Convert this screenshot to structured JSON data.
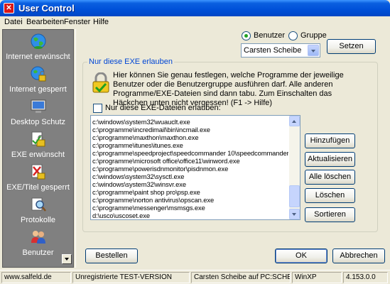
{
  "window": {
    "title": "User Control"
  },
  "menu": [
    "Datei",
    "Bearbeiten",
    "Fenster",
    "Hilfe"
  ],
  "sidebar": {
    "items": [
      {
        "label": "Internet erwünscht",
        "icon": "globe-icon"
      },
      {
        "label": "Internet gesperrt",
        "icon": "globe-lock-icon"
      },
      {
        "label": "Desktop Schutz",
        "icon": "monitor-icon"
      },
      {
        "label": "EXE erwünscht",
        "icon": "exe-lock-icon"
      },
      {
        "label": "EXE/Titel gesperrt",
        "icon": "exe-blocked-icon"
      },
      {
        "label": "Protokolle",
        "icon": "magnifier-icon"
      },
      {
        "label": "Benutzer",
        "icon": "users-icon"
      }
    ]
  },
  "selector": {
    "radio_user": "Benutzer",
    "radio_group": "Gruppe",
    "selected_user": "Carsten Scheibe",
    "set_button": "Setzen"
  },
  "group": {
    "legend": "Nur diese EXE erlauben",
    "info": "Hier können Sie genau festlegen, welche Programme der jeweilige Benutzer oder die Benutzergruppe ausführen darf. Alle anderen Programme/EXE-Dateien sind dann tabu. Zum Einschalten das Häckchen unten nicht vergessen! (F1 -> Hilfe)",
    "checkbox_label": "Nur diese EXE-Dateien erlauben:",
    "files": [
      "c:\\windows\\system32\\wuauclt.exe",
      "c:\\programme\\incredimail\\bin\\incmail.exe",
      "c:\\programme\\maxthon\\maxthon.exe",
      "c:\\programme\\itunes\\itunes.exe",
      "c:\\programme\\speedproject\\speedcommander 10\\speedcommander.exe",
      "c:\\programme\\microsoft office\\office11\\winword.exe",
      "c:\\programme\\powerisdnmonitor\\pisdnmon.exe",
      "c:\\windows\\system32\\sysctl.exe",
      "c:\\windows\\system32\\winsvr.exe",
      "c:\\programme\\paint shop pro\\psp.exe",
      "c:\\programme\\norton antivirus\\opscan.exe",
      "c:\\programme\\messenger\\msmsgs.exe",
      "d:\\usco\\uscoset.exe"
    ],
    "buttons": {
      "add": "Hinzufügen",
      "refresh": "Aktualisieren",
      "delete_all": "Alle löschen",
      "delete": "Löschen",
      "sort": "Sortieren"
    }
  },
  "footer_buttons": {
    "order": "Bestellen",
    "ok": "OK",
    "cancel": "Abbrechen"
  },
  "status": {
    "site": "www.salfeld.de",
    "version_type": "Unregistrierte TEST-VERSION",
    "user_pc": "Carsten Scheibe auf PC:SCHEIBI",
    "os": "WinXP",
    "version": "4.153.0.0"
  }
}
